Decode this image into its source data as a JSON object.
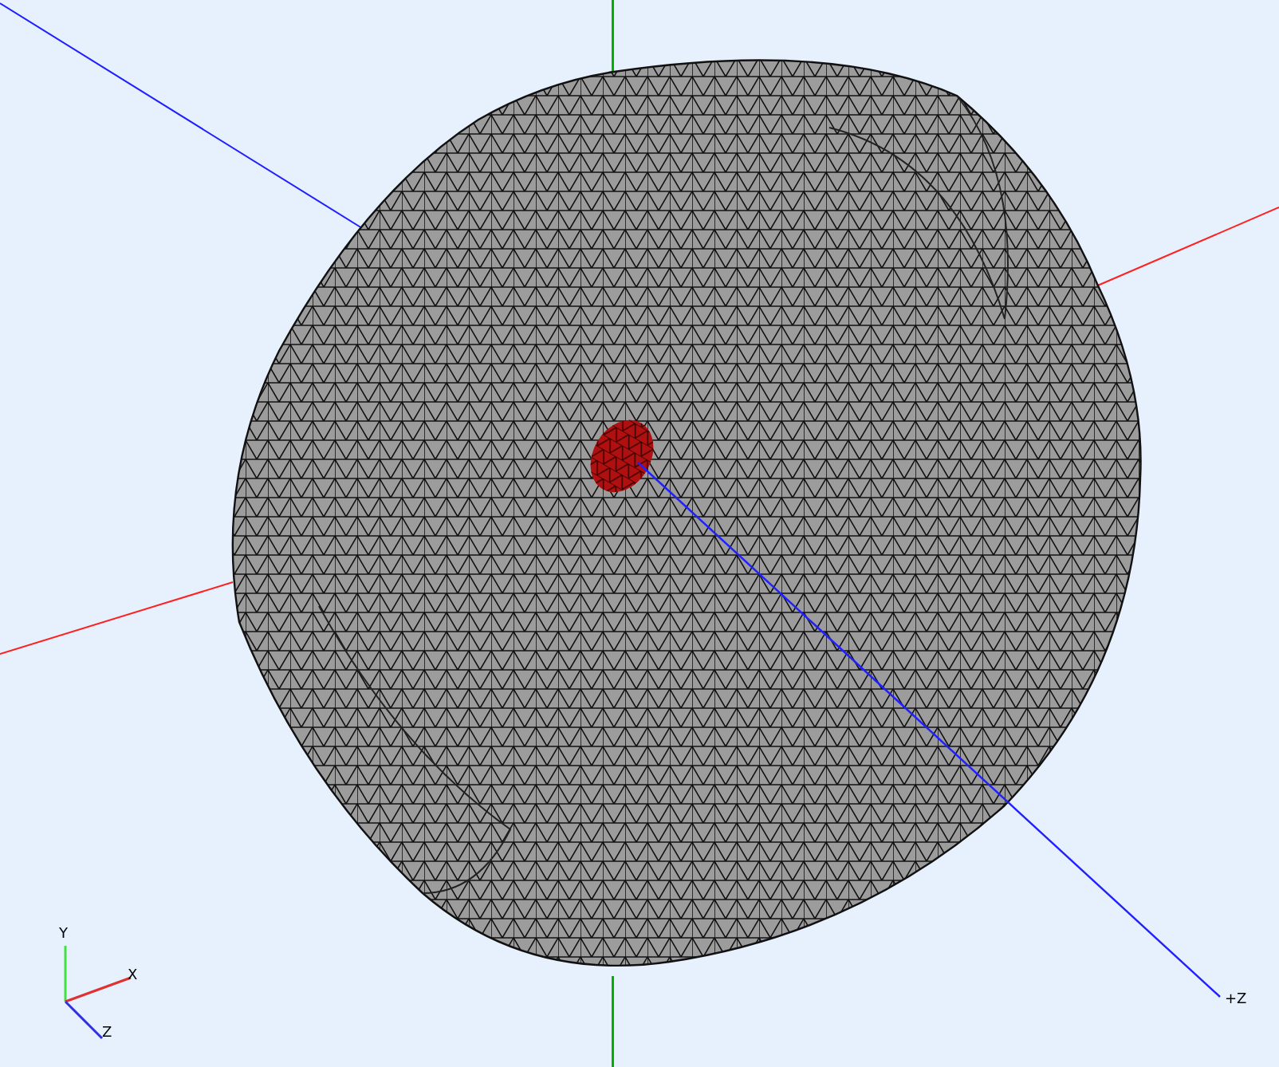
{
  "viewport": {
    "axis_end_label": "+Z"
  },
  "axis_triad": {
    "labels": [
      {
        "kind": "y",
        "text": "Y"
      },
      {
        "kind": "x",
        "text": "X"
      },
      {
        "kind": "z",
        "text": "Z"
      }
    ]
  }
}
